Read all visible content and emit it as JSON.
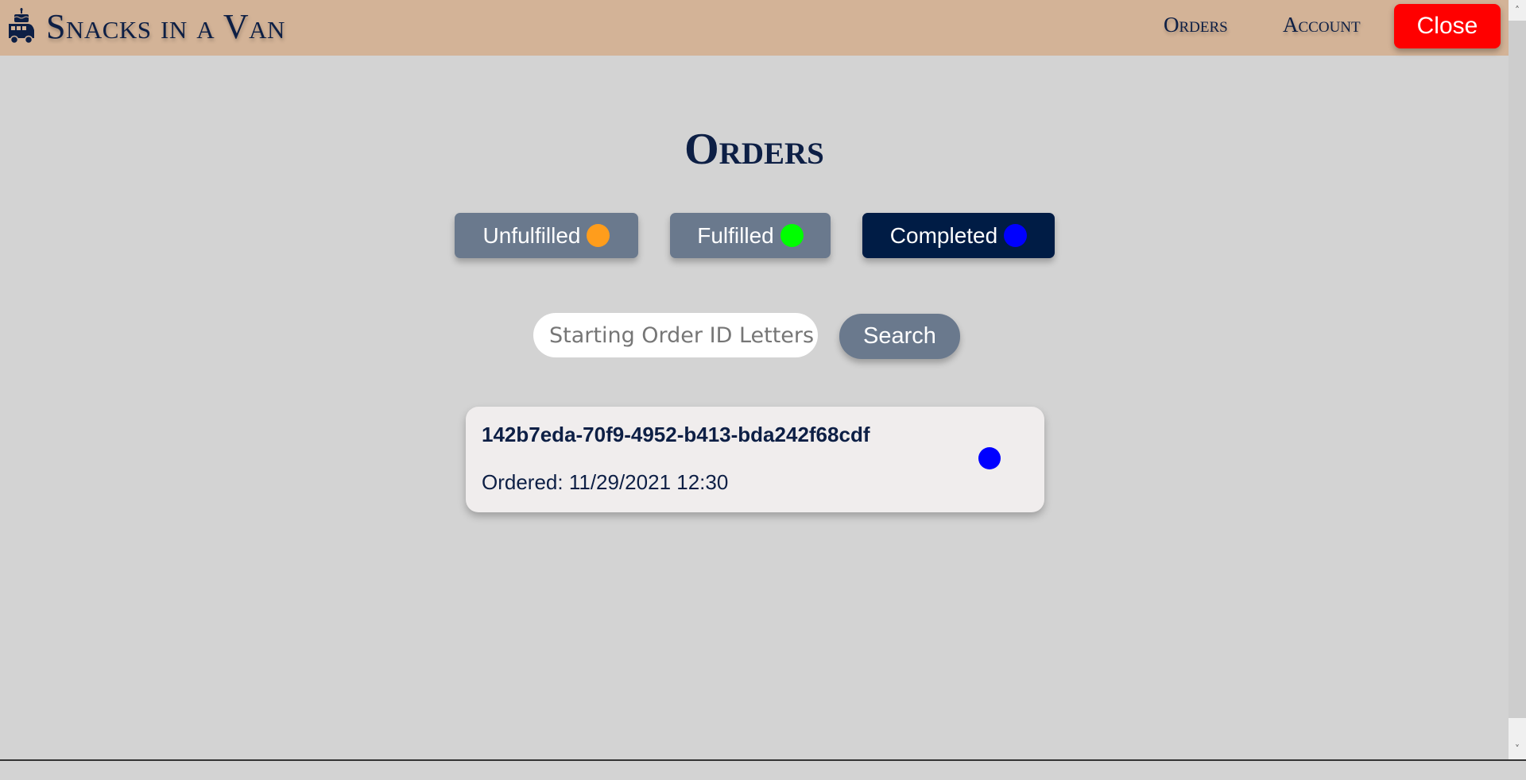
{
  "header": {
    "brand_title": "Snacks in a Van",
    "brand_icon": "van-with-cake-icon",
    "nav": [
      {
        "label": "Orders"
      },
      {
        "label": "Account"
      }
    ],
    "close_label": "Close",
    "close_color": "#ff0000"
  },
  "page": {
    "title": "Orders"
  },
  "filters": [
    {
      "label": "Unfulfilled",
      "dot_color": "#ff9d1c",
      "active": false
    },
    {
      "label": "Fulfilled",
      "dot_color": "#00ff00",
      "active": false
    },
    {
      "label": "Completed",
      "dot_color": "#0000ff",
      "active": true
    }
  ],
  "search": {
    "placeholder": "Starting Order ID Letters",
    "value": "",
    "button_label": "Search"
  },
  "orders": [
    {
      "id": "142b7eda-70f9-4952-b413-bda242f68cdf",
      "ordered_label": "Ordered: 11/29/2021 12:30",
      "status": "Completed",
      "status_color": "#0000ff"
    }
  ],
  "scrollbar": {
    "up_icon": "chevron-up-icon",
    "down_icon": "chevron-down-icon"
  }
}
